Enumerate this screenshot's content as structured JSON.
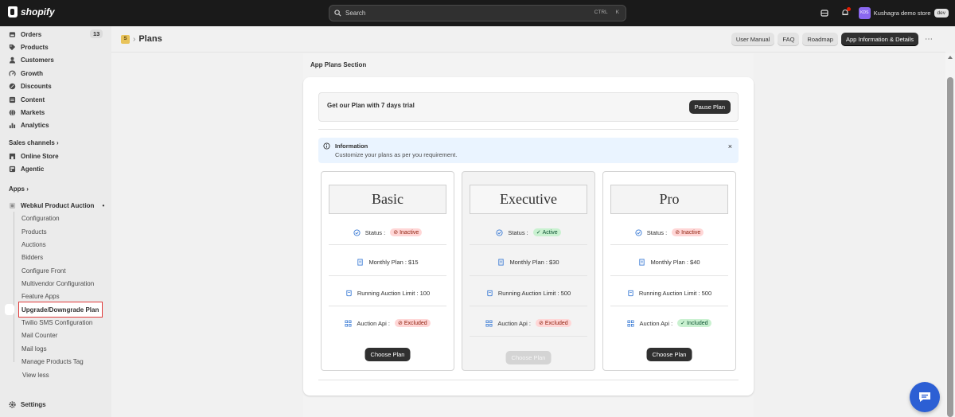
{
  "topbar": {
    "brand": "shopify",
    "search_placeholder": "Search",
    "shortcut_ctrl": "CTRL",
    "shortcut_key": "K",
    "store_initials": "KDS",
    "store_name": "Kushagra demo store",
    "store_badge": "dev"
  },
  "sidebar": {
    "orders": "Orders",
    "orders_count": "13",
    "products": "Products",
    "customers": "Customers",
    "growth": "Growth",
    "discounts": "Discounts",
    "content": "Content",
    "markets": "Markets",
    "analytics": "Analytics",
    "sales_channels": "Sales channels",
    "online_store": "Online Store",
    "agentic": "Agentic",
    "apps": "Apps",
    "app_name": "Webkul Product Auction",
    "sub_items": [
      "Configuration",
      "Products",
      "Auctions",
      "Bidders",
      "Configure Front",
      "Multivendor Configuration",
      "Feature Apps"
    ],
    "active_item": "Upgrade/Downgrade Plan",
    "sub_items_after": [
      "Twilio SMS Configuration",
      "Mail Counter",
      "Mail logs",
      "Manage Products Tag"
    ],
    "view_less": "View less",
    "settings": "Settings"
  },
  "header": {
    "crumb_icon": "S",
    "title": "Plans",
    "buttons": [
      "User Manual",
      "FAQ",
      "Roadmap"
    ],
    "primary_button": "App Information & Details"
  },
  "page": {
    "section_title": "App Plans Section",
    "trial_text": "Get our Plan with 7 days trial",
    "pause_button": "Pause Plan",
    "info_title": "Information",
    "info_desc": "Customize your plans as per you requirement.",
    "info_close": "×"
  },
  "plans": [
    {
      "name": "Basic",
      "status_label": "Status :",
      "status": "Inactive",
      "monthly": "Monthly Plan : $15",
      "limit": "Running Auction Limit : 100",
      "api_label": "Auction Api :",
      "api": "Excluded",
      "button": "Choose Plan"
    },
    {
      "name": "Executive",
      "status_label": "Status :",
      "status": "Active",
      "monthly": "Monthly Plan : $30",
      "limit": "Running Auction Limit : 500",
      "api_label": "Auction Api :",
      "api": "Excluded",
      "button": "Choose Plan"
    },
    {
      "name": "Pro",
      "status_label": "Status :",
      "status": "Inactive",
      "monthly": "Monthly Plan : $40",
      "limit": "Running Auction Limit : 500",
      "api_label": "Auction Api :",
      "api": "Included",
      "button": "Choose Plan"
    }
  ],
  "colors": {
    "topbar": "#1a1a1a",
    "accent_dark": "#303030",
    "active_outline": "#e03a3a",
    "chat": "#2c5fd4",
    "badge_red_bg": "#ffd6d6",
    "badge_green_bg": "#c9f1d0"
  }
}
